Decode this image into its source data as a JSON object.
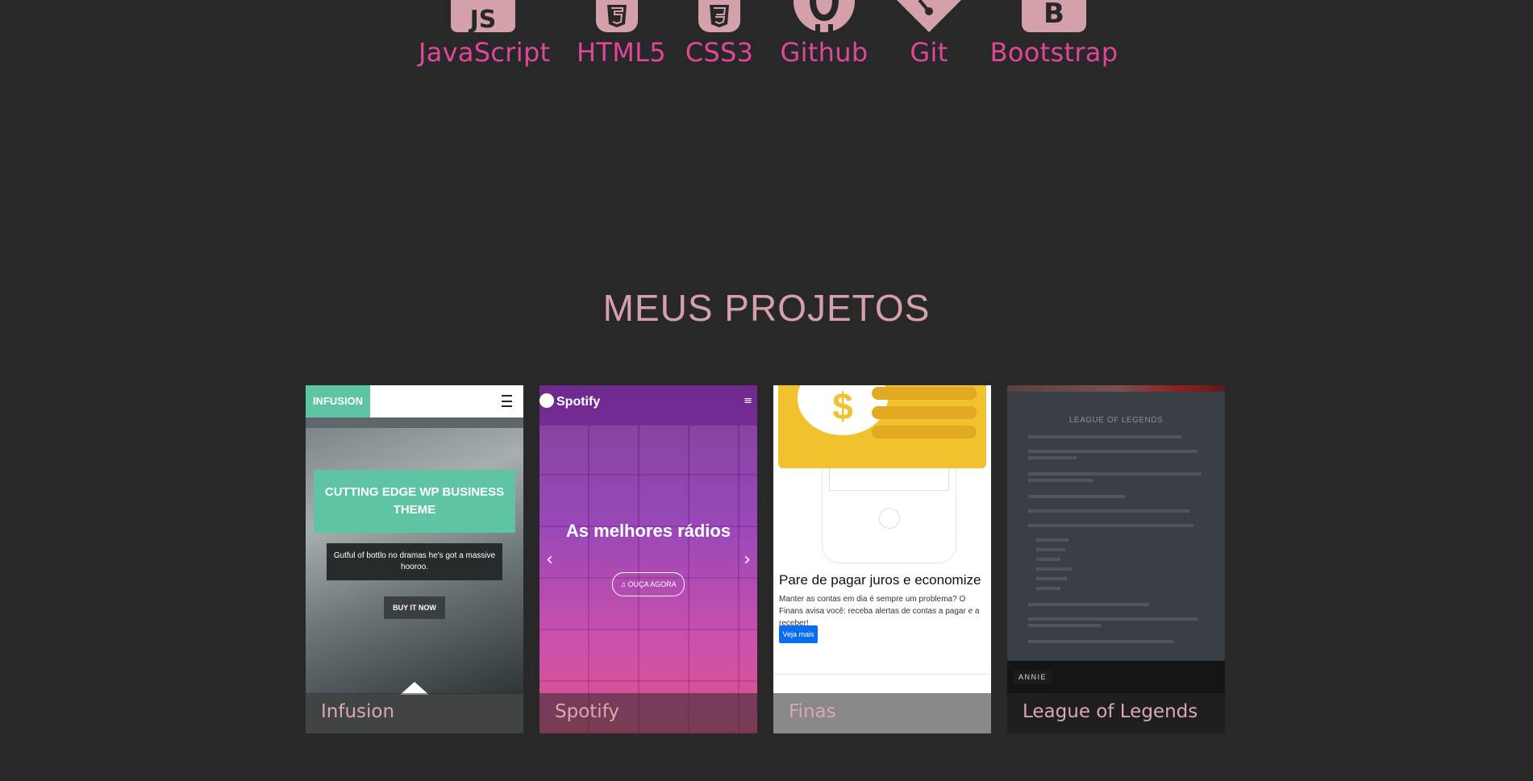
{
  "skills": [
    {
      "label": "JavaScript",
      "icon": "javascript-icon"
    },
    {
      "label": "HTML5",
      "icon": "html5-icon"
    },
    {
      "label": "CSS3",
      "icon": "css3-icon"
    },
    {
      "label": "Github",
      "icon": "github-icon"
    },
    {
      "label": "Git",
      "icon": "git-icon"
    },
    {
      "label": "Bootstrap",
      "icon": "bootstrap-icon"
    }
  ],
  "section_title": "MEUS PROJETOS",
  "projects": [
    {
      "caption": "Infusion",
      "preview": {
        "logo": "INFUSION",
        "headline": "CUTTING EDGE WP BUSINESS THEME",
        "subtext": "Gutful of bottlo no dramas he's got a massive hooroo.",
        "button": "BUY IT NOW"
      }
    },
    {
      "caption": "Spotify",
      "preview": {
        "logo": "Spotify",
        "headline": "As melhores rádios",
        "button": "♫ OUÇA AGORA"
      }
    },
    {
      "caption": "Finas",
      "preview": {
        "symbol": "$",
        "headline": "Pare de pagar juros e economize",
        "text": "Manter as contas em dia é sempre um problema? O Finans avisa você: receba alertas de contas a pagar e a receber!",
        "button": "Veja mais"
      }
    },
    {
      "caption": "League of Legends",
      "preview": {
        "headline": "LEAGUE OF LEGENDS",
        "tag": "ANNIE"
      }
    }
  ],
  "colors": {
    "background": "#282828",
    "accent": "#e0479a",
    "title": "#d4a0aa"
  }
}
